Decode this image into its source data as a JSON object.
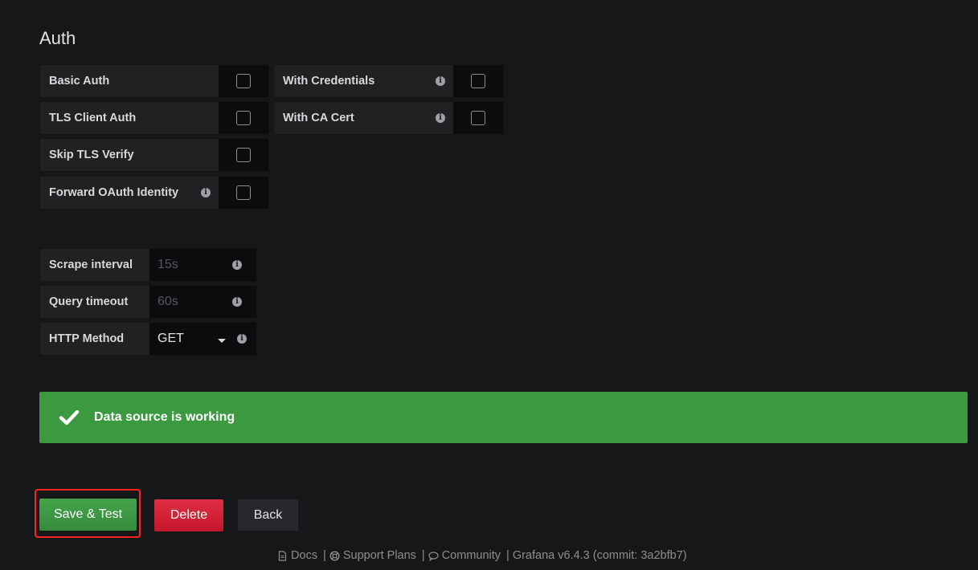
{
  "auth": {
    "title": "Auth",
    "basic_auth": "Basic Auth",
    "with_credentials": "With Credentials",
    "tls_client_auth": "TLS Client Auth",
    "with_ca_cert": "With CA Cert",
    "skip_tls_verify": "Skip TLS Verify",
    "forward_oauth": "Forward OAuth Identity"
  },
  "settings": {
    "scrape_interval_label": "Scrape interval",
    "scrape_interval_placeholder": "15s",
    "query_timeout_label": "Query timeout",
    "query_timeout_placeholder": "60s",
    "http_method_label": "HTTP Method",
    "http_method_value": "GET"
  },
  "alert": {
    "message": "Data source is working",
    "color": "#3b9a40"
  },
  "buttons": {
    "save_test": "Save & Test",
    "delete": "Delete",
    "back": "Back"
  },
  "footer": {
    "docs": "Docs",
    "support": "Support Plans",
    "community": "Community",
    "version": "Grafana v6.4.3 (commit: 3a2bfb7)"
  },
  "icons": {
    "info": "info-circle-icon",
    "check": "check-icon",
    "docs": "file-icon",
    "support": "life-ring-icon",
    "community": "comments-icon"
  }
}
